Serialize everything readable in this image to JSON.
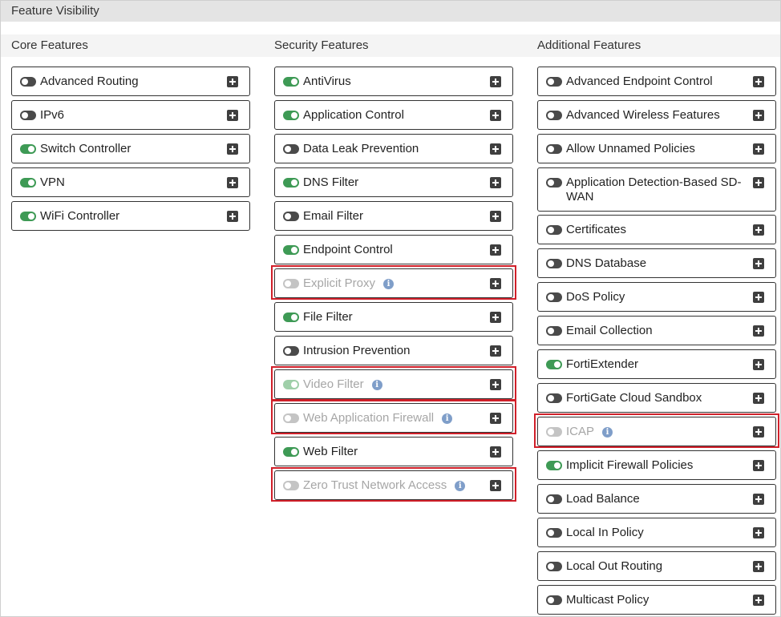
{
  "panel": {
    "title": "Feature Visibility"
  },
  "columns": {
    "core": {
      "title": "Core Features",
      "items": [
        {
          "label": "Advanced Routing",
          "state": "off"
        },
        {
          "label": "IPv6",
          "state": "off"
        },
        {
          "label": "Switch Controller",
          "state": "on"
        },
        {
          "label": "VPN",
          "state": "on"
        },
        {
          "label": "WiFi Controller",
          "state": "on"
        }
      ]
    },
    "security": {
      "title": "Security Features",
      "items": [
        {
          "label": "AntiVirus",
          "state": "on"
        },
        {
          "label": "Application Control",
          "state": "on"
        },
        {
          "label": "Data Leak Prevention",
          "state": "off"
        },
        {
          "label": "DNS Filter",
          "state": "on"
        },
        {
          "label": "Email Filter",
          "state": "off"
        },
        {
          "label": "Endpoint Control",
          "state": "on"
        },
        {
          "label": "Explicit Proxy",
          "state": "disabled-off",
          "info": true,
          "highlighted": true
        },
        {
          "label": "File Filter",
          "state": "on"
        },
        {
          "label": "Intrusion Prevention",
          "state": "off"
        },
        {
          "label": "Video Filter",
          "state": "disabled-on",
          "info": true,
          "highlighted": true
        },
        {
          "label": "Web Application Firewall",
          "state": "disabled-off",
          "info": true,
          "highlighted": true
        },
        {
          "label": "Web Filter",
          "state": "on"
        },
        {
          "label": "Zero Trust Network Access",
          "state": "disabled-off",
          "info": true,
          "highlighted": true
        }
      ]
    },
    "additional": {
      "title": "Additional Features",
      "items": [
        {
          "label": "Advanced Endpoint Control",
          "state": "off"
        },
        {
          "label": "Advanced Wireless Features",
          "state": "off"
        },
        {
          "label": "Allow Unnamed Policies",
          "state": "off"
        },
        {
          "label": "Application Detection-Based SD-WAN",
          "state": "off"
        },
        {
          "label": "Certificates",
          "state": "off"
        },
        {
          "label": "DNS Database",
          "state": "off"
        },
        {
          "label": "DoS Policy",
          "state": "off"
        },
        {
          "label": "Email Collection",
          "state": "off"
        },
        {
          "label": "FortiExtender",
          "state": "on"
        },
        {
          "label": "FortiGate Cloud Sandbox",
          "state": "off"
        },
        {
          "label": "ICAP",
          "state": "disabled-off",
          "info": true,
          "highlighted": true
        },
        {
          "label": "Implicit Firewall Policies",
          "state": "on"
        },
        {
          "label": "Load Balance",
          "state": "off"
        },
        {
          "label": "Local In Policy",
          "state": "off"
        },
        {
          "label": "Local Out Routing",
          "state": "off"
        },
        {
          "label": "Multicast Policy",
          "state": "off"
        }
      ]
    }
  },
  "icons": {
    "toggle": "toggle-switch-icon",
    "expand": "plus-square-icon",
    "info": "info-circle-icon"
  },
  "colors": {
    "toggle_on": "#3e9a55",
    "toggle_off": "#4a4a4a",
    "highlight": "#d0202a",
    "info": "#7f9ec9"
  }
}
